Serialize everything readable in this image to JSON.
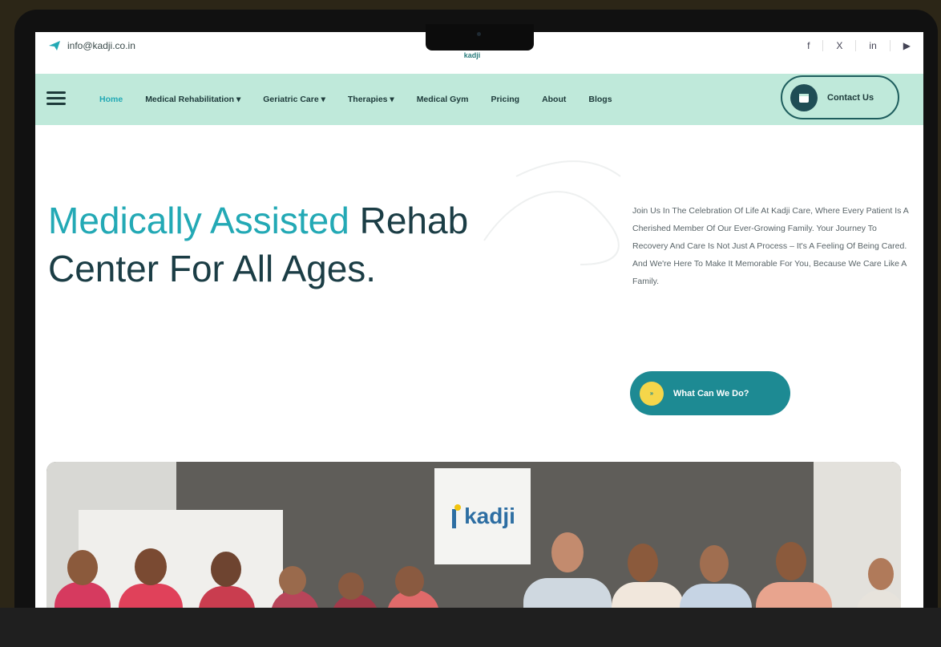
{
  "topbar": {
    "email": "info@kadji.co.in",
    "logo_sub": "kadji",
    "socials": [
      "f",
      "X",
      "in",
      "▶"
    ]
  },
  "nav": {
    "items": [
      {
        "label": "Home",
        "active": true
      },
      {
        "label": "Medical Rehabilitation ▾",
        "active": false
      },
      {
        "label": "Geriatric Care ▾",
        "active": false
      },
      {
        "label": "Therapies ▾",
        "active": false
      },
      {
        "label": "Medical Gym",
        "active": false
      },
      {
        "label": "Pricing",
        "active": false
      },
      {
        "label": "About",
        "active": false
      },
      {
        "label": "Blogs",
        "active": false
      }
    ],
    "contact_label": "Contact Us"
  },
  "hero": {
    "title_accent": "Medically Assisted",
    "title_rest_1": " Rehab",
    "title_line2": "Center For All Ages.",
    "description": "Join Us In The Celebration Of Life At Kadji Care, Where Every Patient Is A Cherished Member Of Our Ever-Growing Family. Your Journey To Recovery And Care Is Not Just A Process – It's A Feeling Of Being Cared. And We're Here To Make It Memorable For You, Because We Care Like A Family.",
    "cta_label": "What Can We Do?",
    "cta_icon": "»"
  },
  "photo": {
    "sign_text": "kadji"
  },
  "colors": {
    "accent": "#23a9b5",
    "nav_bg": "#bfe9da",
    "dark": "#1b3d45",
    "cta_bg": "#1d8a93"
  }
}
